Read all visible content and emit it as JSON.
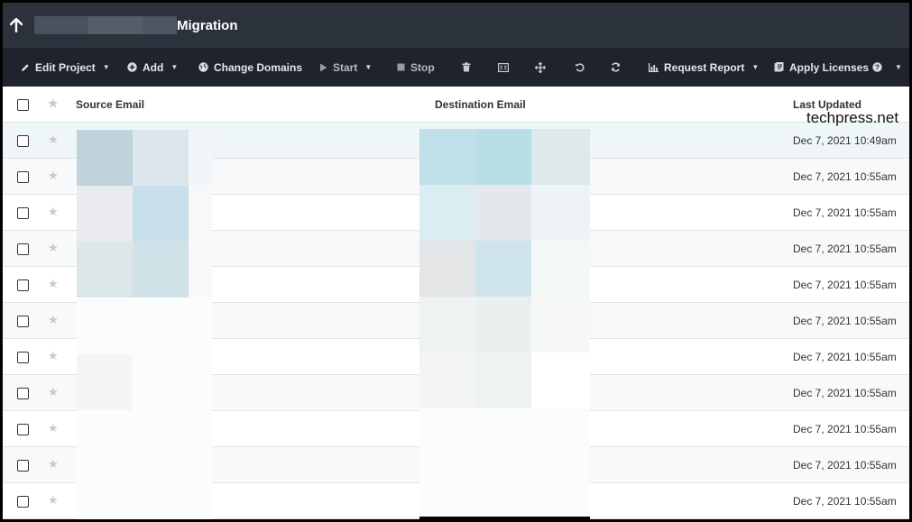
{
  "header": {
    "title": "Migration"
  },
  "toolbar": {
    "edit_project": "Edit Project",
    "add": "Add",
    "change_domains": "Change Domains",
    "start": "Start",
    "stop": "Stop",
    "request_report": "Request Report",
    "apply_licenses": "Apply Licenses"
  },
  "table": {
    "columns": {
      "source": "Source Email",
      "destination": "Destination Email",
      "updated": "Last Updated"
    },
    "rows": [
      {
        "updated": "Dec 7, 2021 10:49am"
      },
      {
        "updated": "Dec 7, 2021 10:55am"
      },
      {
        "updated": "Dec 7, 2021 10:55am"
      },
      {
        "updated": "Dec 7, 2021 10:55am"
      },
      {
        "updated": "Dec 7, 2021 10:55am"
      },
      {
        "updated": "Dec 7, 2021 10:55am"
      },
      {
        "updated": "Dec 7, 2021 10:55am"
      },
      {
        "updated": "Dec 7, 2021 10:55am"
      },
      {
        "updated": "Dec 7, 2021 10:55am"
      },
      {
        "updated": "Dec 7, 2021 10:55am"
      },
      {
        "updated": "Dec 7, 2021 10:55am"
      }
    ]
  },
  "watermark": "techpress.net",
  "colors": {
    "header_bg": "#2b323c",
    "toolbar_bg": "#1f242c",
    "row_alt": "#f7f9fa",
    "row_selected": "#eef6f8"
  },
  "icons": {
    "back": "up-arrow-icon",
    "edit": "pencil-icon",
    "add": "plus-circle-icon",
    "domains": "globe-icon",
    "start": "play-icon",
    "stop": "stop-icon",
    "delete": "trash-icon",
    "columns": "columns-icon",
    "move": "move-icon",
    "undo": "undo-icon",
    "refresh": "refresh-icon",
    "report": "bar-chart-icon",
    "licenses": "license-icon",
    "help": "help-circle-icon"
  }
}
